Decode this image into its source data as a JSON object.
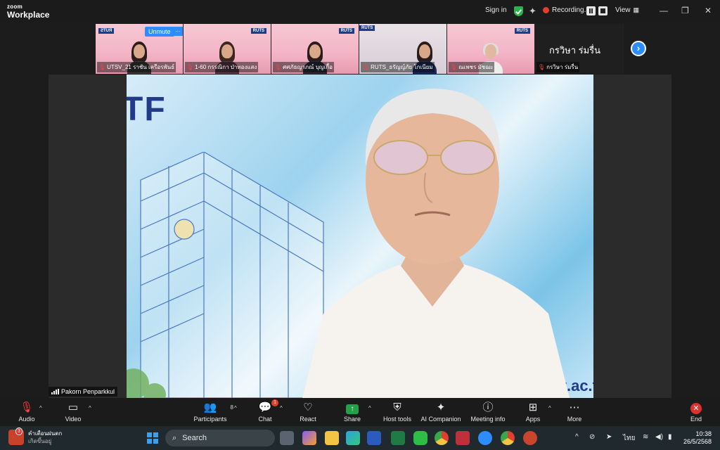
{
  "app": {
    "logo_small": "zoom",
    "logo_big": "Workplace"
  },
  "titlebar": {
    "sign_in": "Sign in",
    "recording": "Recording...",
    "view": "View"
  },
  "thumbnails": [
    {
      "name": "UTSV_21 ราชัน เครือรพันธ์",
      "unmute": "Unmute",
      "more": "···",
      "muted": true
    },
    {
      "name": "1-60 กรรณิกา ป่าทองแสง",
      "muted": true
    },
    {
      "name": "ศศภัธญาภณ์ บุญเกื้อ",
      "muted": true
    },
    {
      "name": "RUTS_ธรัญญ์ภัย โกเนียม",
      "muted": true
    },
    {
      "name": "ณเพชร มัชฌะ",
      "muted": true
    },
    {
      "name": "กรวิษา ร่มรื่น",
      "big_name": "กรวิษา ร่มรื่น",
      "muted": true
    }
  ],
  "main_video": {
    "speaker": "Pakorn Penparkkul",
    "slide_text_left": "TF",
    "slide_text_right": "t.ac.t"
  },
  "controls": [
    {
      "id": "audio",
      "label": "Audio"
    },
    {
      "id": "video",
      "label": "Video"
    },
    {
      "id": "participants",
      "label": "Participants",
      "count": "8"
    },
    {
      "id": "chat",
      "label": "Chat",
      "badge": "1"
    },
    {
      "id": "react",
      "label": "React"
    },
    {
      "id": "share",
      "label": "Share"
    },
    {
      "id": "host_tools",
      "label": "Host tools"
    },
    {
      "id": "ai_companion",
      "label": "AI Companion"
    },
    {
      "id": "meeting_info",
      "label": "Meeting info"
    },
    {
      "id": "apps",
      "label": "Apps"
    },
    {
      "id": "more",
      "label": "More"
    },
    {
      "id": "end",
      "label": "End"
    }
  ],
  "taskbar": {
    "notif_title": "คำเตือนฝนตก",
    "notif_sub": "เกิดขึ้นอยู่",
    "notif_badge": "3",
    "search_placeholder": "Search",
    "lang": "ไทย",
    "time": "10:38",
    "date": "26/5/2568"
  },
  "colors": {
    "accent": "#2d8cff",
    "share_green": "#24a148",
    "end_red": "#e0302b",
    "shield_green": "#2bb24c"
  }
}
